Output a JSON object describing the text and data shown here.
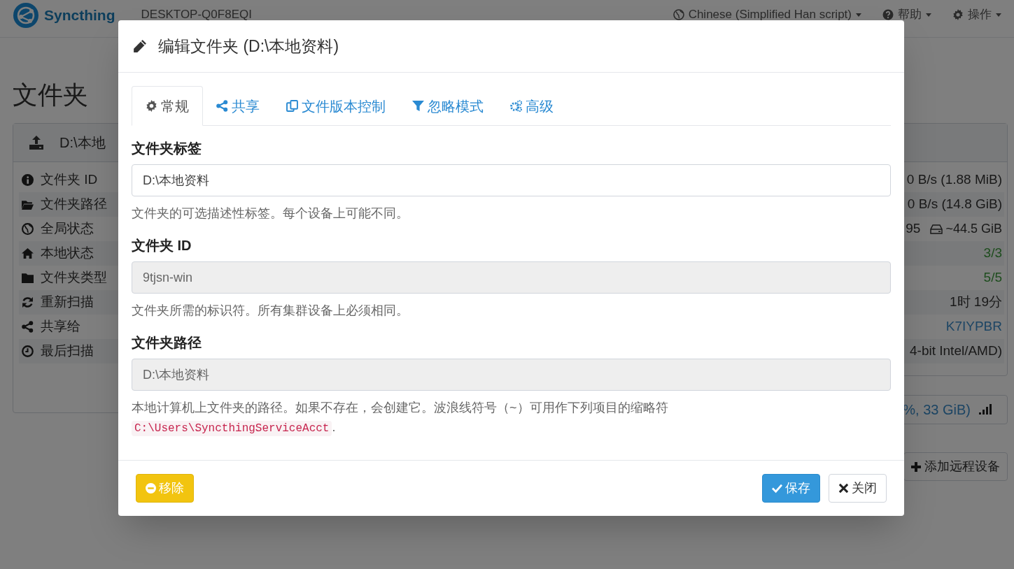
{
  "navbar": {
    "brand": "Syncthing",
    "device_name": "DESKTOP-Q0F8EQI",
    "menus": [
      {
        "label": "Chinese (Simplified Han script)"
      },
      {
        "label": "帮助"
      },
      {
        "label": "操作"
      }
    ]
  },
  "page_title": "文件夹",
  "folder_panel": {
    "title": "D:\\本地",
    "rows": [
      {
        "label": "文件夹 ID"
      },
      {
        "label": "文件夹路径"
      },
      {
        "label": "全局状态"
      },
      {
        "label": "本地状态"
      },
      {
        "label": "文件夹类型"
      },
      {
        "label": "重新扫描"
      },
      {
        "label": "共享给"
      },
      {
        "label": "最后扫描"
      }
    ]
  },
  "device_panel": {
    "values": [
      {
        "text": "0 B/s (1.88 MiB)",
        "kind": "plain"
      },
      {
        "text": "0 B/s (14.8 GiB)",
        "kind": "plain"
      },
      {
        "text": "95",
        "kind": "disk",
        "extra": "~44.5 GiB"
      },
      {
        "text": "3/3",
        "kind": "ok"
      },
      {
        "text": "5/5",
        "kind": "ok"
      },
      {
        "text": "1时 19分",
        "kind": "plain"
      },
      {
        "text": "K7IYPBR",
        "kind": "link"
      },
      {
        "text": "4-bit Intel/AMD)",
        "kind": "plain"
      }
    ]
  },
  "remote_device": {
    "text": "%, 33 GiB)"
  },
  "add_device_button": "添加远程设备",
  "modal": {
    "title": "编辑文件夹 (D:\\本地资料)",
    "tabs": [
      {
        "label": "常规",
        "selected": true
      },
      {
        "label": "共享",
        "selected": false
      },
      {
        "label": "文件版本控制",
        "selected": false
      },
      {
        "label": "忽略模式",
        "selected": false
      },
      {
        "label": "高级",
        "selected": false
      }
    ],
    "fields": [
      {
        "label": "文件夹标签",
        "value": "D:\\本地资料",
        "disabled": false,
        "help": "文件夹的可选描述性标签。每个设备上可能不同。"
      },
      {
        "label": "文件夹 ID",
        "value": "9tjsn-win",
        "disabled": true,
        "help": "文件夹所需的标识符。所有集群设备上必须相同。"
      },
      {
        "label": "文件夹路径",
        "value": "D:\\本地资料",
        "disabled": true,
        "help": "本地计算机上文件夹的路径。如果不存在，会创建它。波浪线符号（~）可用作下列项目的缩略符",
        "help_code": "C:\\Users\\SyncthingServiceAcct",
        "help_suffix": "."
      }
    ],
    "buttons": [
      {
        "label": "移除",
        "kind": "danger"
      },
      {
        "label": "保存",
        "kind": "primary"
      },
      {
        "label": "关闭",
        "kind": "default"
      }
    ]
  }
}
